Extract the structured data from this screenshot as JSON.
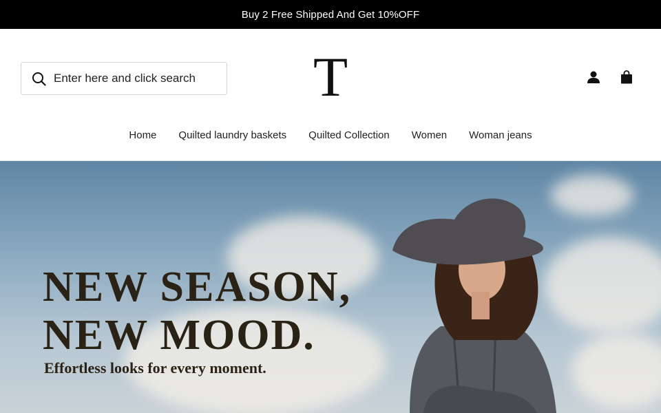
{
  "announcement": "Buy 2 Free Shipped And Get 10%OFF",
  "search": {
    "placeholder": "Enter here and click search"
  },
  "logo": {
    "letter": "T"
  },
  "nav": [
    {
      "label": "Home"
    },
    {
      "label": "Quilted laundry baskets"
    },
    {
      "label": "Quilted Collection"
    },
    {
      "label": "Women"
    },
    {
      "label": "Woman jeans"
    }
  ],
  "hero": {
    "title_line1": "NEW SEASON,",
    "title_line2": "NEW MOOD.",
    "subtitle": "Effortless looks for every moment."
  },
  "icons": {
    "search": "search-icon",
    "account": "user-icon",
    "cart": "shopping-bag-icon"
  },
  "colors": {
    "announcement_bg": "#000000",
    "hero_text": "#2b2216"
  }
}
